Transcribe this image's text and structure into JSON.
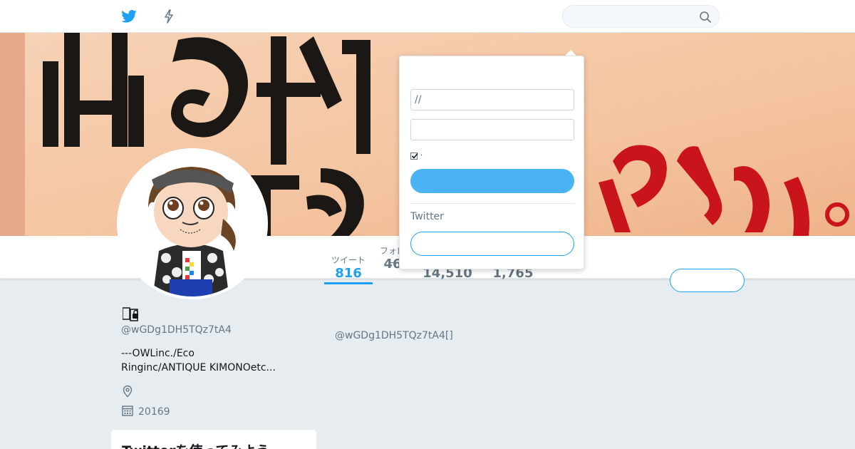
{
  "colors": {
    "accent": "#1da1f2",
    "button_blue": "#4ab3f4",
    "text_muted": "#657786",
    "page_bg": "#e6ecf0"
  },
  "topbar": {
    "home_icon": "twitter-bird-icon",
    "moments_icon": "lightning-icon",
    "search_placeholder": "",
    "search_icon": "search-icon"
  },
  "profile_nav": {
    "stats": [
      {
        "label": "ツイート",
        "value": "816"
      },
      {
        "label": "フォロー",
        "value": "46"
      },
      {
        "label": "",
        "value": "14,510"
      },
      {
        "label": "",
        "value": "1,765"
      }
    ],
    "follow_label": ""
  },
  "profile": {
    "name": "",
    "handle": "@wGDg1DH5TQz7tA4",
    "bio_line1": "---OWLinc./Eco",
    "bio_line2": "Ringinc/ANTIQUE KIMONOetc...",
    "joined": "20169"
  },
  "card": {
    "title": "Twitterを使ってみよう"
  },
  "main": {
    "title": "",
    "subtitle": "@wGDg1DH5TQz7tA4[]"
  },
  "login_dropdown": {
    "username_value": "//",
    "password_value": "",
    "remember_label": "·",
    "login_label": "",
    "section_label": "Twitter",
    "signup_label": ""
  }
}
